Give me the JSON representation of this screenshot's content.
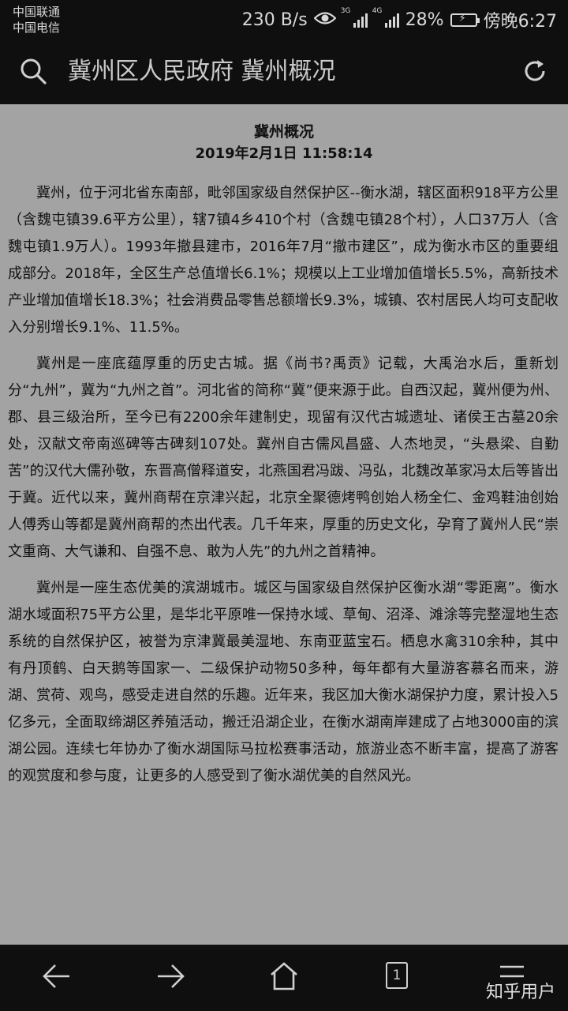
{
  "status_bar": {
    "carrier_1": "中国联通",
    "carrier_2": "中国电信",
    "net_speed": "230 B/s",
    "net_3g": "3G",
    "net_4g": "4G",
    "battery": "28%",
    "time": "傍晚6:27"
  },
  "toolbar": {
    "title": "冀州区人民政府 冀州概况"
  },
  "article": {
    "title": "冀州概况",
    "date": "2019年2月1日 11:58:14",
    "paragraphs": [
      "冀州，位于河北省东南部，毗邻国家级自然保护区--衡水湖，辖区面积918平方公里（含魏屯镇39.6平方公里），辖7镇4乡410个村（含魏屯镇28个村），人口37万人（含魏屯镇1.9万人）。1993年撤县建市，2016年7月“撤市建区”，成为衡水市区的重要组成部分。2018年，全区生产总值增长6.1%；规模以上工业增加值增长5.5%，高新技术产业增加值增长18.3%；社会消费品零售总额增长9.3%，城镇、农村居民人均可支配收入分别增长9.1%、11.5%。",
      "冀州是一座底蕴厚重的历史古城。据《尚书?禹贡》记载，大禹治水后，重新划分“九州”，冀为“九州之首”。河北省的简称“冀”便来源于此。自西汉起，冀州便为州、郡、县三级治所，至今已有2200余年建制史，现留有汉代古城遗址、诸侯王古墓20余处，汉献文帝南巡碑等古碑刻107处。冀州自古儒风昌盛、人杰地灵，“头悬梁、自勤苦”的汉代大儒孙敬，东晋高僧释道安，北燕国君冯跋、冯弘，北魏改革家冯太后等皆出于冀。近代以来，冀州商帮在京津兴起，北京全聚德烤鸭创始人杨全仁、金鸡鞋油创始人傅秀山等都是冀州商帮的杰出代表。几千年来，厚重的历史文化，孕育了冀州人民“崇文重商、大气谦和、自强不息、敢为人先”的九州之首精神。",
      "冀州是一座生态优美的滨湖城市。城区与国家级自然保护区衡水湖“零距离”。衡水湖水域面积75平方公里，是华北平原唯一保持水域、草甸、沼泽、滩涂等完整湿地生态系统的自然保护区，被誉为京津冀最美湿地、东南亚蓝宝石。栖息水禽310余种，其中有丹顶鹤、白天鹅等国家一、二级保护动物50多种，每年都有大量游客慕名而来，游湖、赏荷、观鸟，感受走进自然的乐趣。近年来，我区加大衡水湖保护力度，累计投入5亿多元，全面取缔湖区养殖活动，搬迁沿湖企业，在衡水湖南岸建成了占地3000亩的滨湖公园。连续七年协办了衡水湖国际马拉松赛事活动，旅游业态不断丰富，提高了游客的观赏度和参与度，让更多的人感受到了衡水湖优美的自然风光。"
    ]
  },
  "nav_bar": {
    "tab_count": "1",
    "watermark": "知乎用户"
  }
}
